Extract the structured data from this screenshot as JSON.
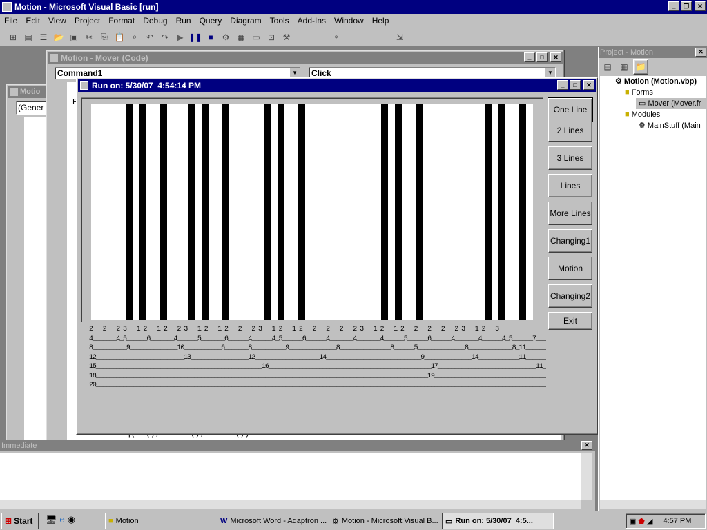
{
  "app": {
    "title": "Motion - Microsoft Visual Basic [run]"
  },
  "menu": [
    "File",
    "Edit",
    "View",
    "Project",
    "Format",
    "Debug",
    "Run",
    "Query",
    "Diagram",
    "Tools",
    "Add-Ins",
    "Window",
    "Help"
  ],
  "code_window": {
    "title": "Motion - Mover (Code)",
    "object_combo": "Command1",
    "proc_combo": "Click",
    "code_fragment": "P",
    "code_bottom": "Call Recsq(ss(), scats(), svals())"
  },
  "second_window": {
    "title": "Motio",
    "combo": "(Gener"
  },
  "run_form": {
    "title": "Run on: 5/30/07  4:54:14 PM",
    "buttons": [
      "One Line",
      "2 Lines",
      "3 Lines",
      "Lines",
      "More Lines",
      "Changing1",
      "Motion",
      "Changing2",
      "Exit"
    ],
    "label_rows": [
      "2___2___2_3___1_2___1_2___2_3___1_2___1_2___2___2_3___1_2___1_2___2___2___2___2_3___1_2___1_2___2___2___2___2_3___1_2___3",
      "4_______4_5______6_______4______5_______6______4______4_5______6______4_______4_______4______5______6______4_______4______4_5______7_______",
      "8__________9______________10___________6_______8__________9______________8_______________8______5______________8_____________8_11_________",
      "12__________________________13_________________12___________________14____________________________9______________14____________11_________",
      "15_________________________________________________16________________________________________________17_____________________________11_________",
      "18__________________________________________________________________________________________________19___________________________________",
      "20_______________________________________________________________________________________________________________________________________"
    ]
  },
  "project": {
    "title": "Project - Motion",
    "root": "Motion (Motion.vbp)",
    "forms_folder": "Forms",
    "form_item": "Mover (Mover.fr",
    "modules_folder": "Modules",
    "module_item": "MainStuff (Main"
  },
  "immediate": {
    "title": "Immediate"
  },
  "taskbar": {
    "start": "Start",
    "tasks": [
      "Motion",
      "Microsoft Word - Adaptron ...",
      "Motion - Microsoft Visual B...",
      "Run on: 5/30/07  4:5..."
    ],
    "clock": "4:57 PM"
  }
}
